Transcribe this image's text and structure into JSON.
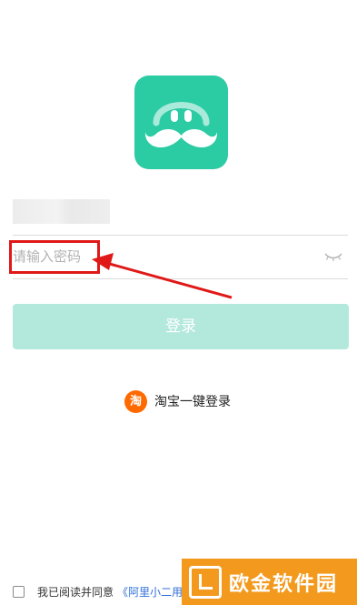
{
  "login": {
    "password_placeholder": "请输入密码",
    "submit_label": "登录",
    "taobao_icon_glyph": "淘",
    "taobao_label": "淘宝一键登录"
  },
  "agreement": {
    "prefix": "我已阅读并同意",
    "link_text": "《阿里小二用户协议》《隐私权政策》"
  },
  "watermark": {
    "text": "欧金软件园"
  },
  "icons": {
    "logo": "mustache-smile-icon",
    "password_toggle": "eye-closed-icon",
    "taobao": "taobao-icon"
  },
  "colors": {
    "brand": "#2bcba3",
    "button_disabled": "#b3e8dc",
    "annotation": "#e01818",
    "link": "#2f6fd9",
    "taobao": "#ff6a00",
    "watermark": "#f39a1e"
  }
}
